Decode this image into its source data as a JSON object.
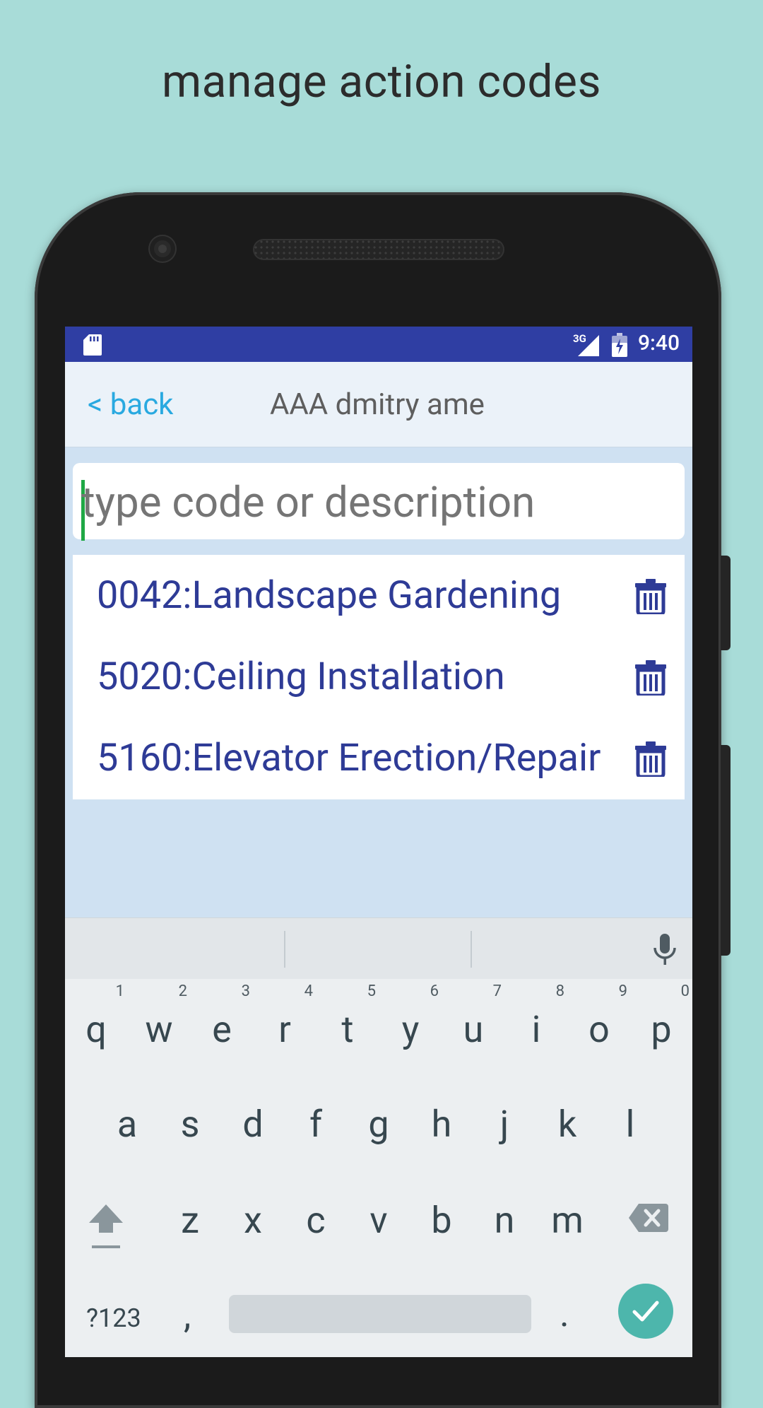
{
  "headline": "manage action codes",
  "status_bar": {
    "network": "3G",
    "time": "9:40"
  },
  "header": {
    "back_label": "< back",
    "title": "AAA dmitry ame"
  },
  "search": {
    "placeholder": "type code or description",
    "value": ""
  },
  "action_codes": [
    {
      "label": "0042:Landscape Gardening"
    },
    {
      "label": "5020:Ceiling Installation"
    },
    {
      "label": "5160:Elevator Erection/Repair"
    }
  ],
  "keyboard": {
    "row1": [
      {
        "key": "q",
        "hint": "1"
      },
      {
        "key": "w",
        "hint": "2"
      },
      {
        "key": "e",
        "hint": "3"
      },
      {
        "key": "r",
        "hint": "4"
      },
      {
        "key": "t",
        "hint": "5"
      },
      {
        "key": "y",
        "hint": "6"
      },
      {
        "key": "u",
        "hint": "7"
      },
      {
        "key": "i",
        "hint": "8"
      },
      {
        "key": "o",
        "hint": "9"
      },
      {
        "key": "p",
        "hint": "0"
      }
    ],
    "row2": [
      "a",
      "s",
      "d",
      "f",
      "g",
      "h",
      "j",
      "k",
      "l"
    ],
    "row3": [
      "z",
      "x",
      "c",
      "v",
      "b",
      "n",
      "m"
    ],
    "symbols_label": "?123",
    "comma": ",",
    "period": "."
  },
  "colors": {
    "background": "#a8dcd8",
    "status_bar": "#2f3ea3",
    "code_text": "#2e3b96",
    "back_link": "#29a9e0",
    "enter_key": "#4db6ac"
  },
  "icons": [
    "sd-card-icon",
    "signal-icon",
    "battery-icon",
    "trash-icon",
    "mic-icon",
    "shift-icon",
    "backspace-icon",
    "check-icon"
  ]
}
